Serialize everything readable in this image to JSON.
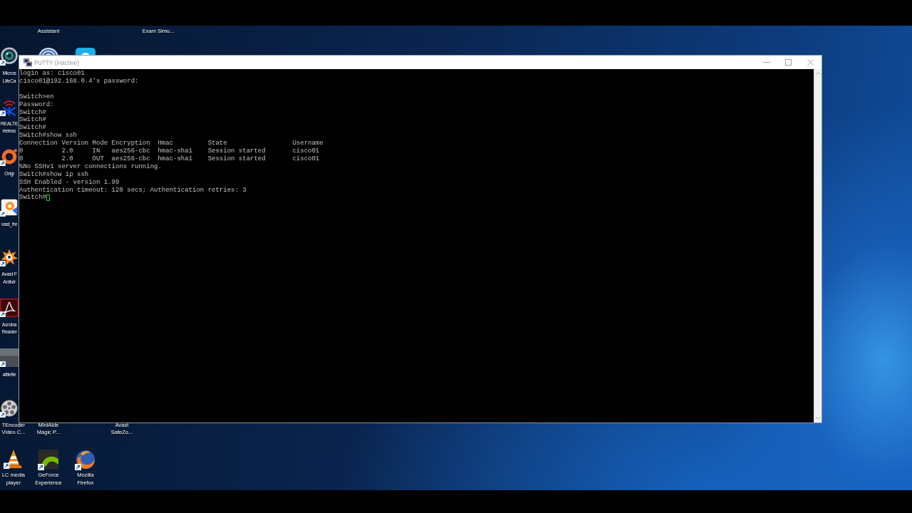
{
  "desktop": {
    "icons": [
      {
        "kind": "webcam",
        "label": [
          "Micros",
          "LifeCa"
        ]
      },
      {
        "kind": "wireless",
        "label": [
          "REALTE",
          "ireless"
        ]
      },
      {
        "kind": "ring",
        "label": [
          "Origi"
        ]
      },
      {
        "kind": "installer",
        "label": [
          "vast_fre"
        ]
      },
      {
        "kind": "splat",
        "label": [
          "Avast F",
          "Antivir"
        ]
      },
      {
        "kind": "swirl",
        "label": [
          "Acroba",
          "Reader"
        ]
      },
      {
        "kind": "picture",
        "label": [
          "attlefie"
        ]
      },
      {
        "kind": "reel",
        "label": [
          "TEncoder",
          "Video C..."
        ]
      },
      {
        "kind": "cone",
        "label": [
          "LC media",
          "player"
        ]
      },
      {
        "kind": "hidden",
        "label": [
          "Assistant"
        ]
      },
      {
        "kind": "rings"
      },
      {
        "kind": "hidden",
        "label": [
          "MiniAide",
          "Magic P..."
        ]
      },
      {
        "kind": "swoosh",
        "label": [
          "GeForce",
          "Experience"
        ]
      },
      {
        "kind": "tile"
      },
      {
        "kind": "foxglobe",
        "label": [
          "Mozilla",
          "Firefox"
        ]
      },
      {
        "kind": "hidden",
        "label": [
          "Avast",
          "SafeZo..."
        ]
      },
      {
        "kind": "hidden",
        "label": [
          "Exam Simu..."
        ]
      }
    ]
  },
  "window": {
    "title": "PuTTY (inactive)",
    "terminal": {
      "blocks": [
        [
          "login as: cisco01",
          "cisco01@192.168.0.4's password:"
        ],
        [
          "Switch>en",
          "Password:",
          "Switch#",
          "Switch#",
          "Switch#",
          "Switch#show ssh",
          "Connection Version Mode Encryption  Hmac         State                 Username",
          "0          2.0     IN   aes256-cbc  hmac-sha1    Session started       cisco01",
          "0          2.0     OUT  aes256-cbc  hmac-sha1    Session started       cisco01",
          "%No SSHv1 server connections running.",
          "Switch#show ip ssh",
          "SSH Enabled - version 1.99",
          "Authentication timeout: 120 secs; Authentication retries: 3"
        ]
      ],
      "prompt": "Switch#"
    }
  }
}
